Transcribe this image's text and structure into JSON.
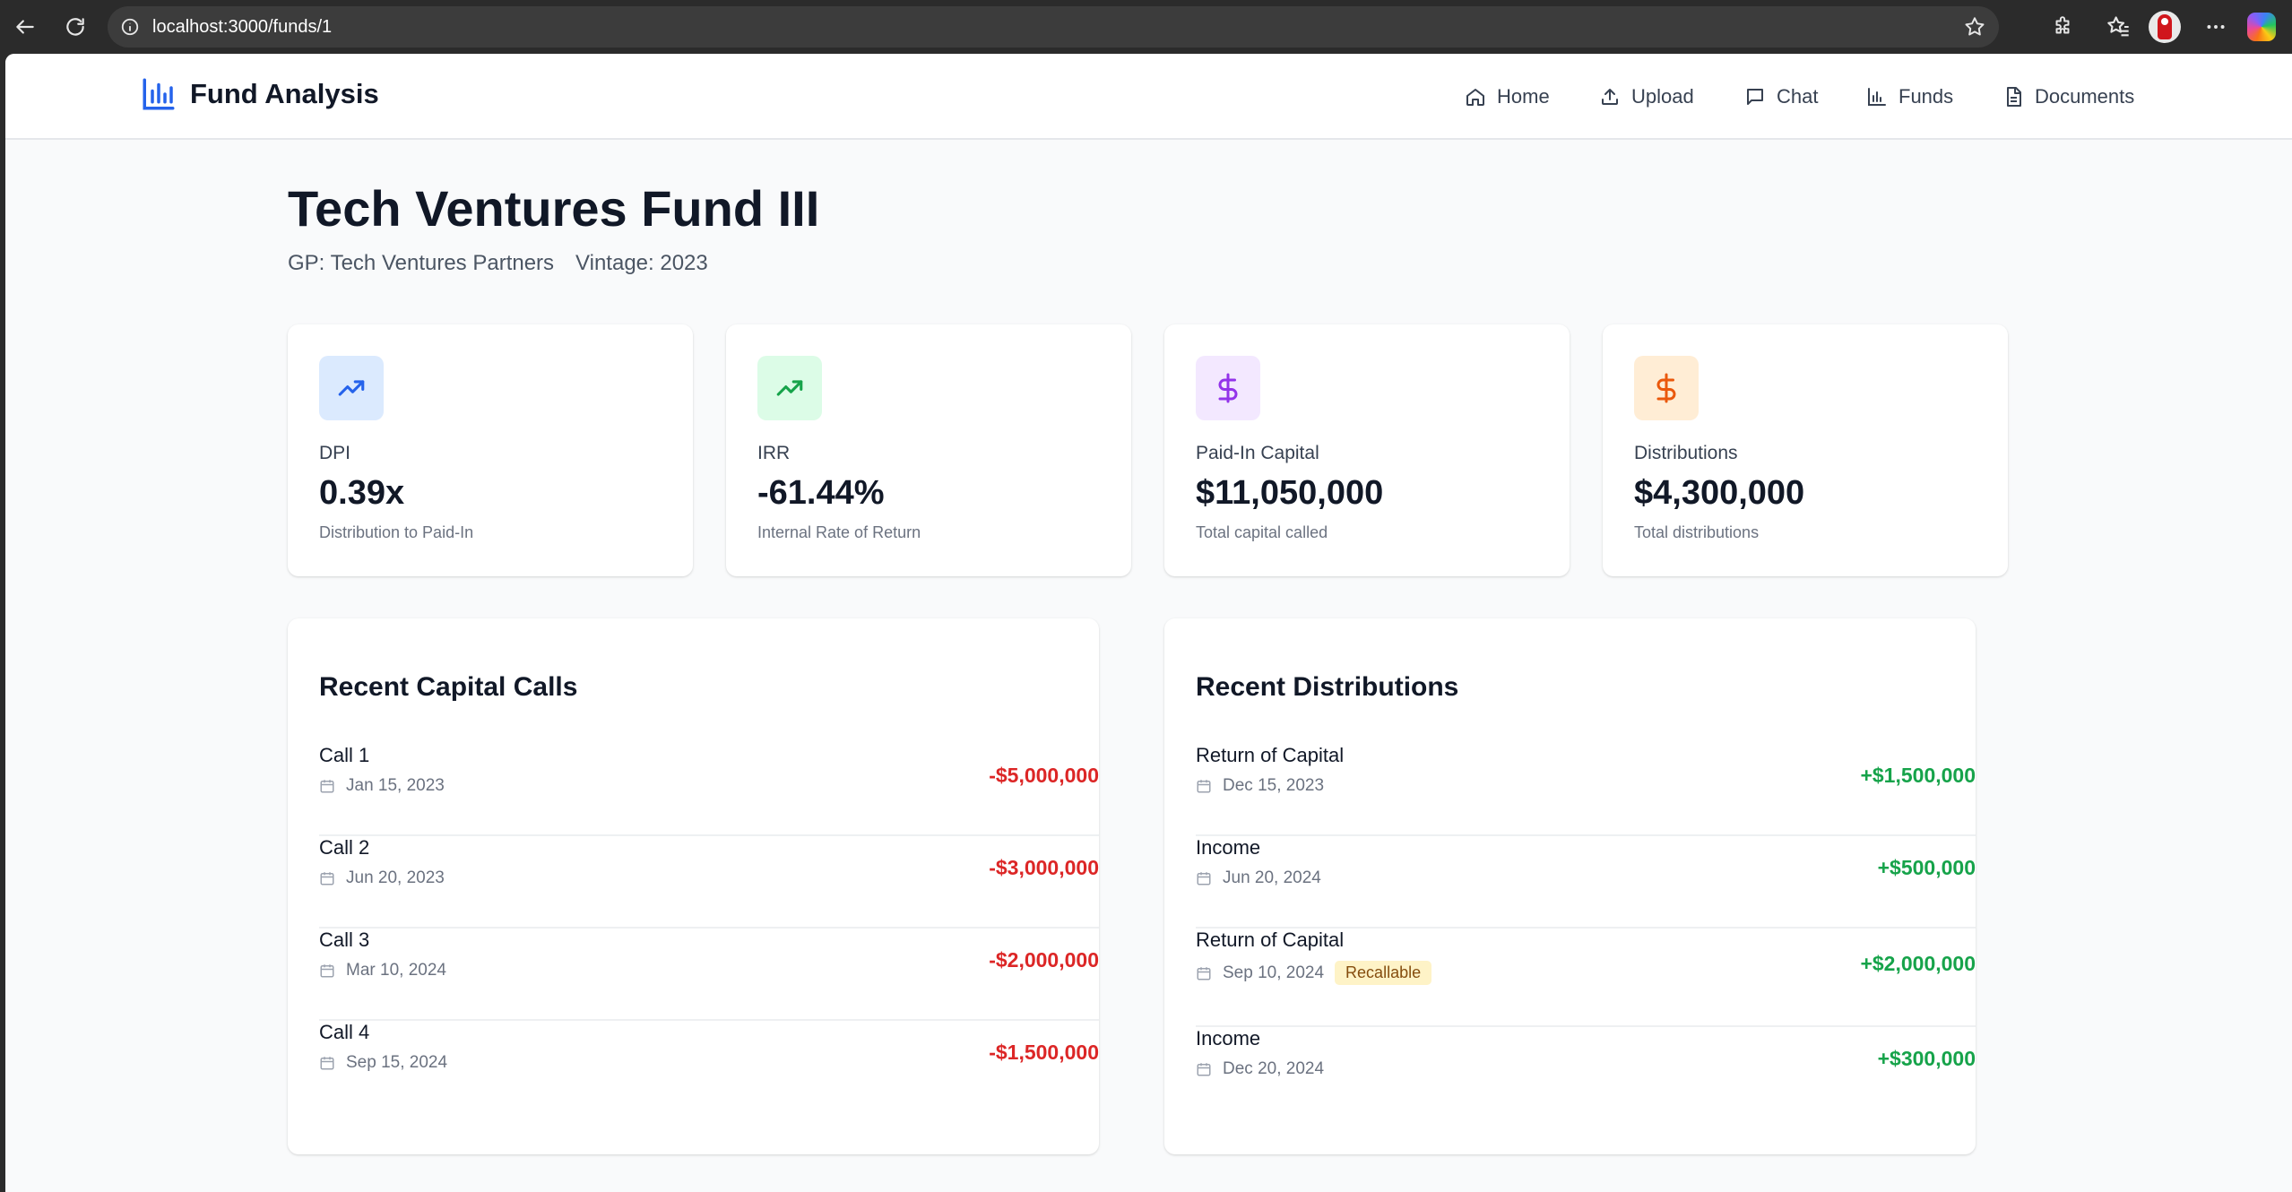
{
  "browser": {
    "url": "localhost:3000/funds/1"
  },
  "navbar": {
    "brand": "Fund Analysis",
    "items": [
      {
        "label": "Home",
        "icon": "home-icon"
      },
      {
        "label": "Upload",
        "icon": "upload-icon"
      },
      {
        "label": "Chat",
        "icon": "chat-icon"
      },
      {
        "label": "Funds",
        "icon": "bar-chart-icon"
      },
      {
        "label": "Documents",
        "icon": "document-icon"
      }
    ]
  },
  "fund": {
    "name": "Tech Ventures Fund III",
    "gp": "GP: Tech Ventures Partners",
    "vintage": "Vintage: 2023"
  },
  "stats": [
    {
      "label": "DPI",
      "value": "0.39x",
      "desc": "Distribution to Paid-In",
      "icon": "trending-up-icon",
      "icon_color": "#2563eb",
      "icon_bg": "#dbeafe"
    },
    {
      "label": "IRR",
      "value": "-61.44%",
      "desc": "Internal Rate of Return",
      "icon": "trending-up-icon",
      "icon_color": "#16a34a",
      "icon_bg": "#dcfce7"
    },
    {
      "label": "Paid-In Capital",
      "value": "$11,050,000",
      "desc": "Total capital called",
      "icon": "dollar-icon",
      "icon_color": "#9333ea",
      "icon_bg": "#f3e8ff"
    },
    {
      "label": "Distributions",
      "value": "$4,300,000",
      "desc": "Total distributions",
      "icon": "dollar-icon",
      "icon_color": "#ea580c",
      "icon_bg": "#ffedd5"
    }
  ],
  "capital_calls": {
    "title": "Recent Capital Calls",
    "items": [
      {
        "title": "Call 1",
        "date": "Jan 15, 2023",
        "amount": "-$5,000,000"
      },
      {
        "title": "Call 2",
        "date": "Jun 20, 2023",
        "amount": "-$3,000,000"
      },
      {
        "title": "Call 3",
        "date": "Mar 10, 2024",
        "amount": "-$2,000,000"
      },
      {
        "title": "Call 4",
        "date": "Sep 15, 2024",
        "amount": "-$1,500,000"
      }
    ]
  },
  "distributions": {
    "title": "Recent Distributions",
    "items": [
      {
        "title": "Return of Capital",
        "date": "Dec 15, 2023",
        "amount": "+$1,500,000",
        "badge": ""
      },
      {
        "title": "Income",
        "date": "Jun 20, 2024",
        "amount": "+$500,000",
        "badge": ""
      },
      {
        "title": "Return of Capital",
        "date": "Sep 10, 2024",
        "amount": "+$2,000,000",
        "badge": "Recallable"
      },
      {
        "title": "Income",
        "date": "Dec 20, 2024",
        "amount": "+$300,000",
        "badge": ""
      }
    ]
  },
  "colors": {
    "negative": "#dc2626",
    "positive": "#16a34a",
    "brand": "#2563eb"
  }
}
